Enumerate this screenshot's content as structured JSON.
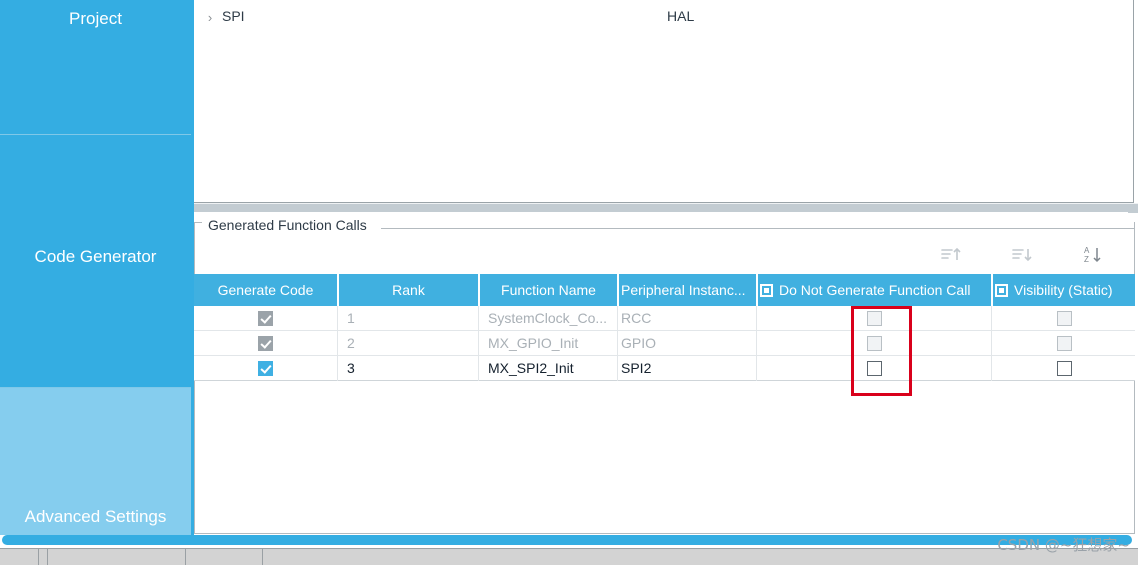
{
  "theme": {
    "accent_blue": "#34ade2",
    "header_blue": "#40b0e0",
    "tab_hover_blue": "#85cdee",
    "highlight_red": "#d9001b",
    "disabled_gray": "#a9b0b6",
    "splitter_gray": "#c3ccd2"
  },
  "tabs": {
    "items": [
      {
        "label": "Project",
        "state": "normal"
      },
      {
        "label": "Code Generator",
        "state": "selected"
      },
      {
        "label": "Advanced Settings",
        "state": "hover"
      }
    ]
  },
  "top_panel": {
    "expander_icon": "chevron-right-icon",
    "peripheral": "SPI",
    "driver": "HAL"
  },
  "group": {
    "title": "Generated Function Calls"
  },
  "toolbar": {
    "icons": [
      {
        "name": "sort-ascending-icon",
        "enabled": false
      },
      {
        "name": "sort-descending-icon",
        "enabled": false
      },
      {
        "name": "sort-alphabetical-icon",
        "enabled": true
      }
    ]
  },
  "table": {
    "columns": [
      {
        "label": "Generate Code",
        "has_checkbox": false,
        "align": "center"
      },
      {
        "label": "Rank",
        "has_checkbox": false,
        "align": "center"
      },
      {
        "label": "Function Name",
        "has_checkbox": false,
        "align": "center"
      },
      {
        "label": "Peripheral Instanc...",
        "has_checkbox": false,
        "align": "left"
      },
      {
        "label": "Do Not Generate Function Call",
        "has_checkbox": true,
        "align": "center"
      },
      {
        "label": "Visibility (Static)",
        "has_checkbox": true,
        "align": "center"
      }
    ],
    "rows": [
      {
        "generate_code": "checked-disabled",
        "rank": "1",
        "function_name": "SystemClock_Co...",
        "peripheral_instance": "RCC",
        "do_not_generate": "unchecked-disabled",
        "visibility_static": "unchecked-disabled",
        "enabled": false
      },
      {
        "generate_code": "checked-disabled",
        "rank": "2",
        "function_name": "MX_GPIO_Init",
        "peripheral_instance": "GPIO",
        "do_not_generate": "unchecked-disabled",
        "visibility_static": "unchecked-disabled",
        "enabled": false
      },
      {
        "generate_code": "checked-enabled",
        "rank": "3",
        "function_name": "MX_SPI2_Init",
        "peripheral_instance": "SPI2",
        "do_not_generate": "unchecked-enabled",
        "visibility_static": "unchecked-enabled",
        "enabled": true
      }
    ]
  },
  "annotation": {
    "highlight_column": "Do Not Generate Function Call"
  },
  "watermark": {
    "text": "CSDN @~狂想家~"
  }
}
